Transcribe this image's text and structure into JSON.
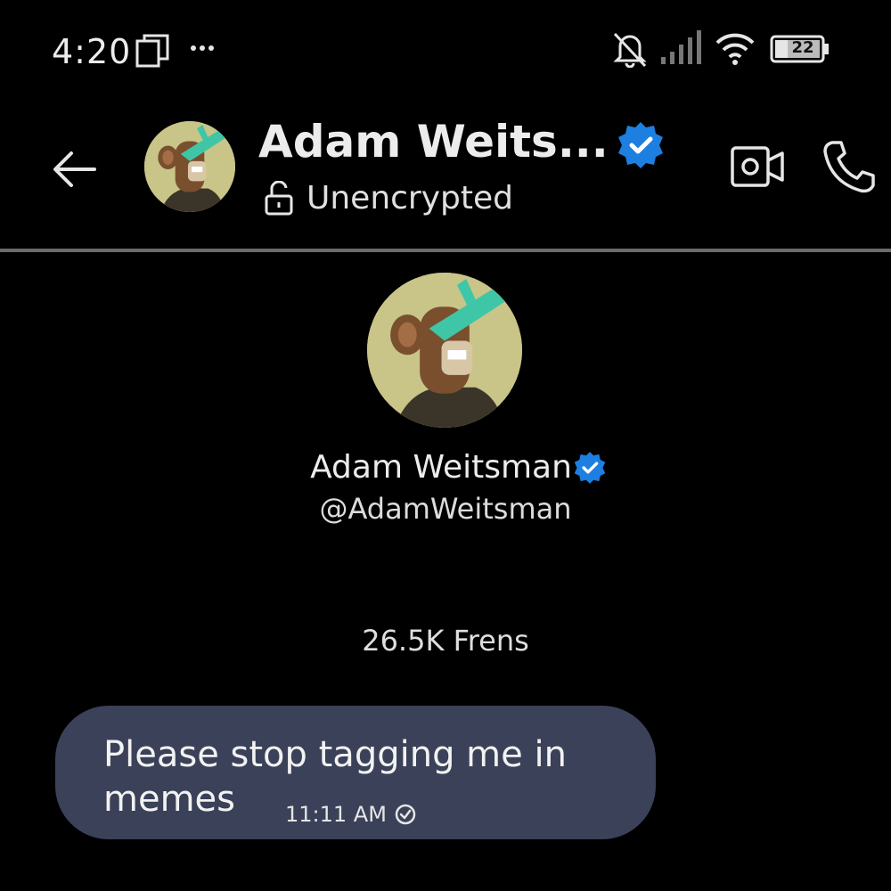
{
  "status_bar": {
    "time": "4:20",
    "battery_level": "22",
    "icons": [
      "copy-icon",
      "more-dots-icon",
      "bell-muted-icon",
      "signal-icon",
      "wifi-icon",
      "battery-icon"
    ]
  },
  "header": {
    "contact_name": "Adam Weits...",
    "encryption_status": "Unencrypted",
    "icons": [
      "back-arrow-icon",
      "avatar",
      "verified-badge-icon",
      "unlock-icon",
      "video-call-icon",
      "phone-icon"
    ]
  },
  "profile": {
    "name": "Adam Weitsman",
    "handle": "@AdamWeitsman",
    "followers": "26.5K Frens"
  },
  "messages": [
    {
      "text": "Please stop tagging me in memes",
      "time": "11:11 AM",
      "status_icon": "sent-check-icon"
    }
  ],
  "colors": {
    "background": "#000000",
    "bubble": "#3a4158",
    "verified": "#1d7fe0",
    "avatar_bg": "#c9c488",
    "divider": "#6b6b6b"
  }
}
